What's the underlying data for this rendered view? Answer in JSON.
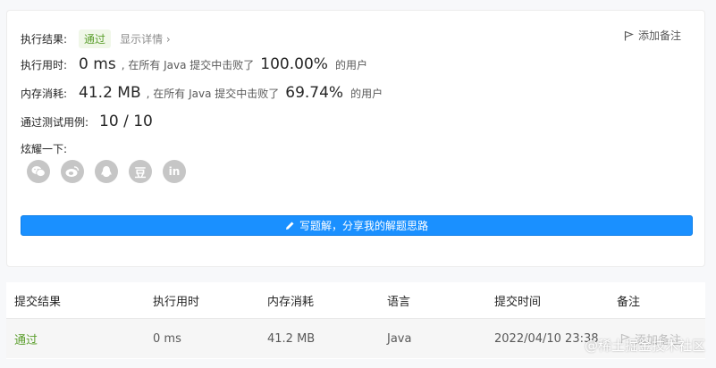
{
  "result": {
    "label": "执行结果:",
    "status": "通过",
    "detail": "显示详情",
    "detail_arrow": "›",
    "add_note": "添加备注"
  },
  "runtime": {
    "label": "执行用时:",
    "value": "0 ms",
    "middle": ", 在所有 Java 提交中击败了",
    "percent": "100.00%",
    "suffix": "的用户"
  },
  "memory": {
    "label": "内存消耗:",
    "value": "41.2 MB",
    "middle": ", 在所有 Java 提交中击败了",
    "percent": "69.74%",
    "suffix": "的用户"
  },
  "tests": {
    "label": "通过测试用例:",
    "value": "10 / 10"
  },
  "share": {
    "label": "炫耀一下:",
    "icons": [
      "wechat-icon",
      "weibo-icon",
      "qq-icon",
      "douban-icon",
      "linkedin-icon"
    ],
    "douban_glyph": "豆",
    "linkedin_glyph": "in"
  },
  "write_button": "写题解，分享我的解题思路",
  "table": {
    "headers": [
      "提交结果",
      "执行用时",
      "内存消耗",
      "语言",
      "提交时间",
      "备注"
    ],
    "row": {
      "status": "通过",
      "runtime": "0 ms",
      "memory": "41.2 MB",
      "language": "Java",
      "time": "2022/04/10 23:38",
      "note": "添加备注"
    }
  },
  "watermark": "@稀土掘金技术社区",
  "colors": {
    "accent": "#1a90ff",
    "pass": "#5a9e2b",
    "pass_bg": "#f0f7e8"
  }
}
